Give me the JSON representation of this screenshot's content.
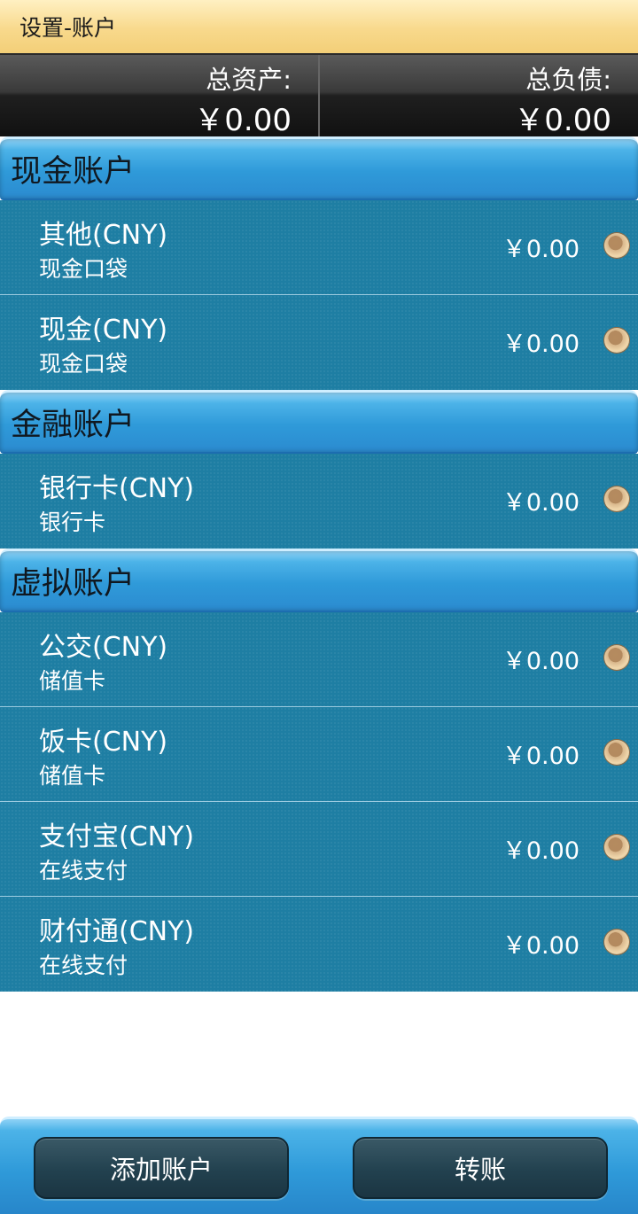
{
  "header": {
    "title": "设置-账户"
  },
  "summary": {
    "assets_label": "总资产:",
    "assets_value": "￥0.00",
    "liabilities_label": "总负债:",
    "liabilities_value": "￥0.00"
  },
  "sections": [
    {
      "title": "现金账户",
      "accounts": [
        {
          "name": "其他(CNY)",
          "type": "现金口袋",
          "amount": "￥0.00"
        },
        {
          "name": "现金(CNY)",
          "type": "现金口袋",
          "amount": "￥0.00"
        }
      ]
    },
    {
      "title": "金融账户",
      "accounts": [
        {
          "name": "银行卡(CNY)",
          "type": "银行卡",
          "amount": "￥0.00"
        }
      ]
    },
    {
      "title": "虚拟账户",
      "accounts": [
        {
          "name": "公交(CNY)",
          "type": "储值卡",
          "amount": "￥0.00"
        },
        {
          "name": "饭卡(CNY)",
          "type": "储值卡",
          "amount": "￥0.00"
        },
        {
          "name": "支付宝(CNY)",
          "type": "在线支付",
          "amount": "￥0.00"
        },
        {
          "name": "财付通(CNY)",
          "type": "在线支付",
          "amount": "￥0.00"
        }
      ]
    }
  ],
  "toolbar": {
    "add_account_label": "添加账户",
    "transfer_label": "转账"
  },
  "colors": {
    "titlebar": "#f8d98c",
    "section_header": "#2f9ad9",
    "row_background": "#1e7ea3",
    "button": "#22414f"
  },
  "icons": {
    "row_indicator": "tan-circle-icon"
  }
}
